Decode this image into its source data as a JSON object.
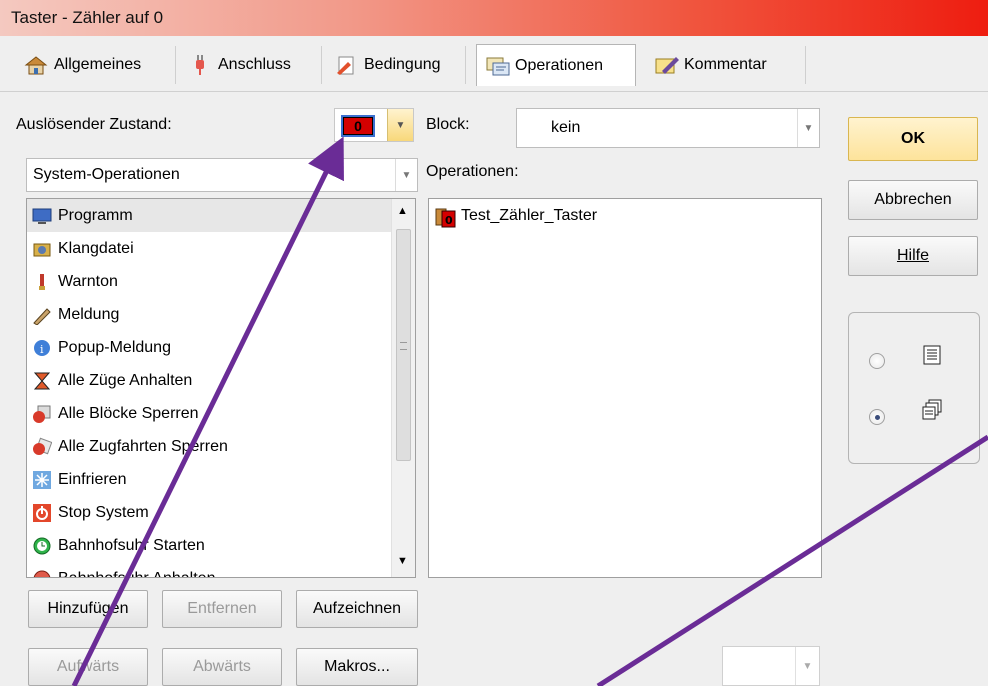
{
  "window": {
    "title": "Taster - Zähler auf 0"
  },
  "tabs": [
    {
      "label": "Allgemeines",
      "icon": "house-icon"
    },
    {
      "label": "Anschluss",
      "icon": "plug-icon"
    },
    {
      "label": "Bedingung",
      "icon": "condition-icon"
    },
    {
      "label": "Operationen",
      "icon": "operations-icon",
      "active": true
    },
    {
      "label": "Kommentar",
      "icon": "comment-icon"
    }
  ],
  "trigger": {
    "label": "Auslösender Zustand:",
    "value": "0"
  },
  "block": {
    "label": "Block:",
    "value": "kein"
  },
  "category": {
    "value": "System-Operationen"
  },
  "operations": {
    "label": "Operationen:",
    "items": [
      "Test_Zähler_Taster"
    ]
  },
  "list": {
    "items": [
      {
        "label": "Programm",
        "icon": "monitor-icon"
      },
      {
        "label": "Klangdatei",
        "icon": "speaker-icon"
      },
      {
        "label": "Warnton",
        "icon": "alarm-icon"
      },
      {
        "label": "Meldung",
        "icon": "pencil-icon"
      },
      {
        "label": "Popup-Meldung",
        "icon": "info-icon"
      },
      {
        "label": "Alle Züge Anhalten",
        "icon": "hourglass-icon"
      },
      {
        "label": "Alle Blöcke Sperren",
        "icon": "block-lock-icon"
      },
      {
        "label": "Alle Zugfahrten Sperren",
        "icon": "route-lock-icon"
      },
      {
        "label": "Einfrieren",
        "icon": "snowflake-icon"
      },
      {
        "label": "Stop System",
        "icon": "power-icon"
      },
      {
        "label": "Bahnhofsuhr Starten",
        "icon": "clock-icon"
      },
      {
        "label": "Bahnhofsuhr Anhalten",
        "icon": "clock-stop-icon"
      }
    ]
  },
  "buttons": {
    "add": "Hinzufügen",
    "remove": "Entfernen",
    "record": "Aufzeichnen",
    "up": "Aufwärts",
    "down": "Abwärts",
    "macros": "Makros...",
    "ok": "OK",
    "cancel": "Abbrechen",
    "help": "Hilfe"
  },
  "colors": {
    "annotation_arrow": "#6a2c96",
    "ok_button": "#fde39b",
    "state_indicator": "#d40000"
  }
}
